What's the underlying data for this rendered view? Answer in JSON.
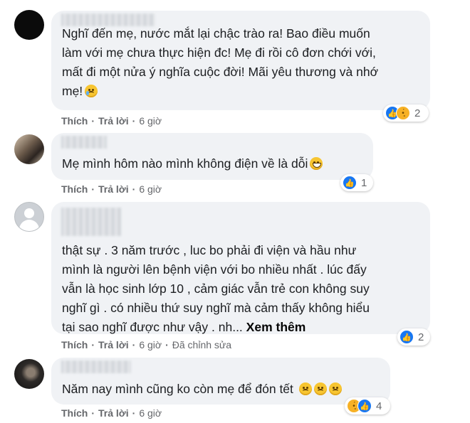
{
  "colors": {
    "bubble_bg": "#f0f2f5",
    "action_text": "#65676b",
    "like_blue": "#1877f2",
    "sad_yellow": "#f7b125"
  },
  "comments": [
    {
      "avatar": "black-circle-avatar",
      "text": "Nghĩ đến mẹ, nước mắt lại chậc trào ra! Bao điều muốn\nlàm với mẹ chưa thực hiện đc! Mẹ đi rồi cô đơn chới với,\nmất đi một nửa ý nghĩa cuộc đời! Mãi yêu thương và nhớ\nmẹ!",
      "emoji": "sad-tear-emoji",
      "actions": {
        "like": "Thích",
        "reply": "Trả lời",
        "time": "6 giờ"
      },
      "reactions": {
        "icons": [
          "like-icon",
          "sad-icon"
        ],
        "count": "2"
      }
    },
    {
      "avatar": "photo-avatar",
      "text": "Mẹ mình hôm nào mình không điện về là dỗi",
      "emoji": "grin-emoji",
      "actions": {
        "like": "Thích",
        "reply": "Trả lời",
        "time": "6 giờ"
      },
      "reactions": {
        "icons": [
          "like-icon"
        ],
        "count": "1"
      }
    },
    {
      "avatar": "default-avatar",
      "text": "thật sự . 3 năm trước , luc bo phải đi viện và hầu như\nmình là người lên bệnh viện với bo nhiều nhất . lúc đấy\nvẫn là học sinh lớp 10 , cảm giác vẫn trẻ con không suy\nnghĩ gì . có nhiều thứ suy nghĩ mà cảm thấy không hiểu\ntại sao nghĩ được như vậy . nh...",
      "see_more": "Xem thêm",
      "actions": {
        "like": "Thích",
        "reply": "Trả lời",
        "time": "6 giờ",
        "edited": "Đã chỉnh sửa"
      },
      "reactions": {
        "icons": [
          "like-icon"
        ],
        "count": "2"
      }
    },
    {
      "avatar": "dark-photo-avatar",
      "text": "Năm nay mình cũng ko còn mẹ để đón tết",
      "emoji": "disappointed-emoji",
      "actions": {
        "like": "Thích",
        "reply": "Trả lời",
        "time": "6 giờ"
      },
      "reactions": {
        "icons": [
          "sad-icon",
          "like-icon"
        ],
        "count": "4"
      }
    }
  ]
}
